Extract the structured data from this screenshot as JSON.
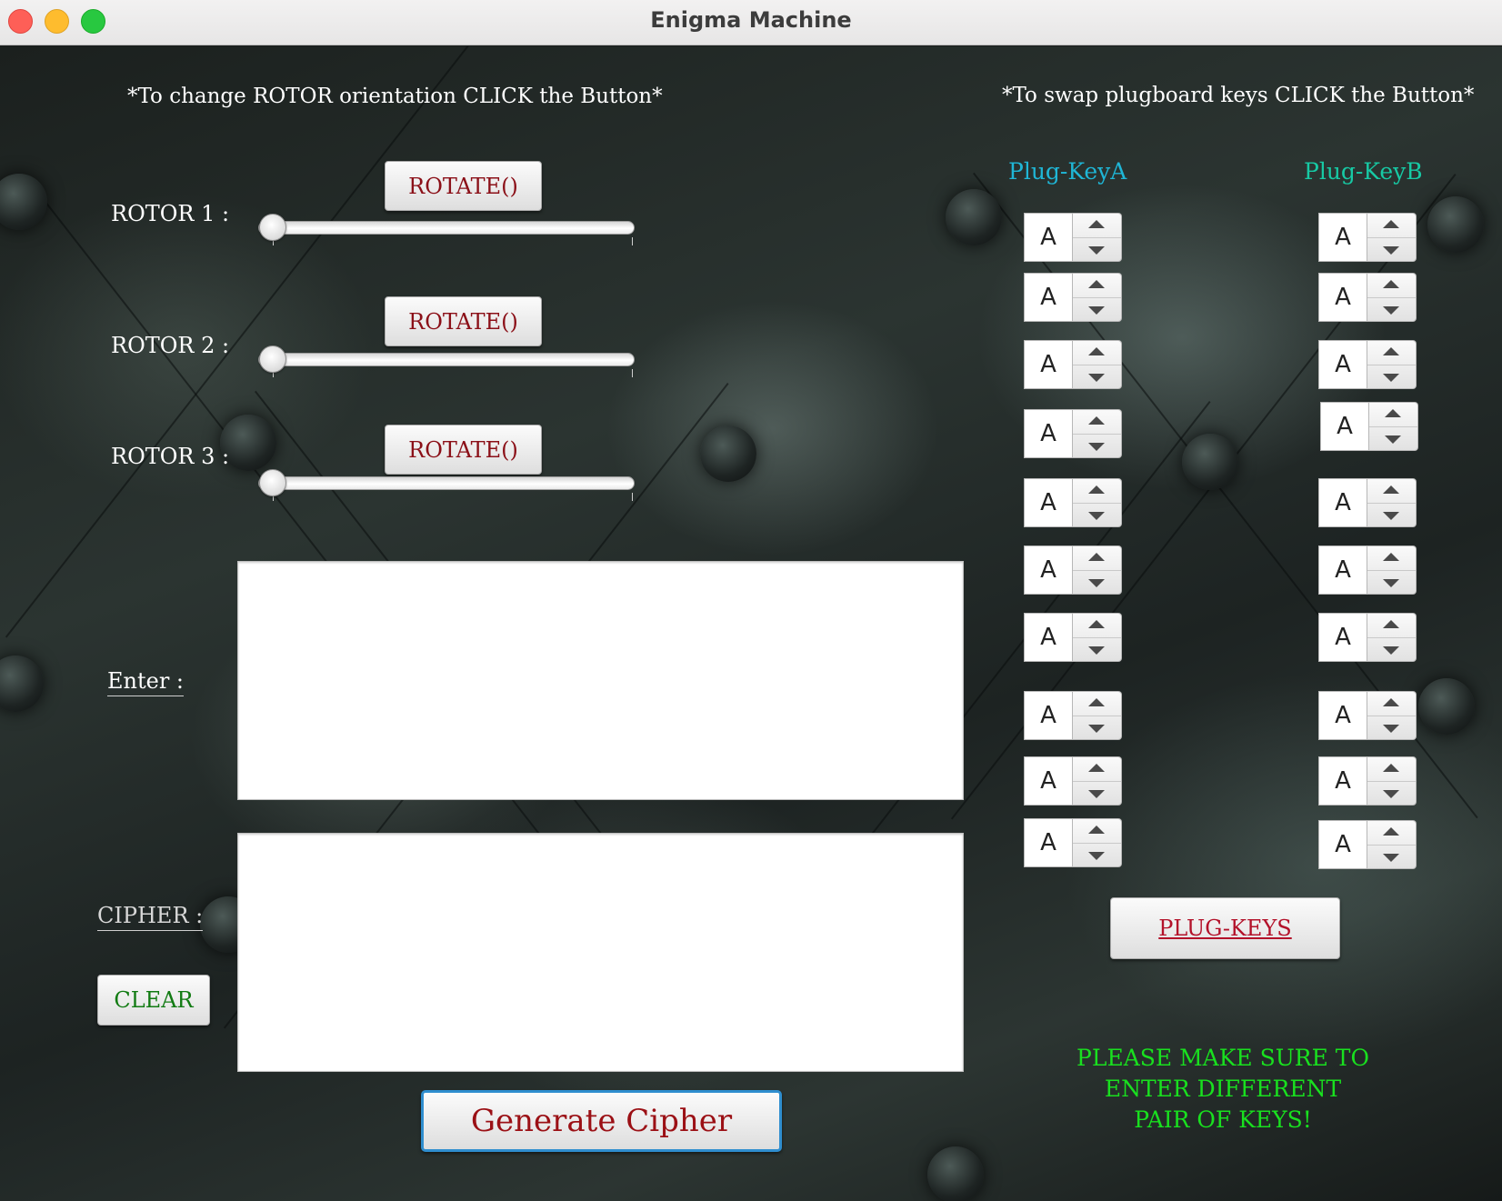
{
  "window": {
    "title": "Enigma Machine"
  },
  "hints": {
    "rotor": "*To change ROTOR orientation CLICK the Button*",
    "plugboard": "*To swap plugboard keys CLICK the Button*"
  },
  "rotors": [
    {
      "label": "ROTOR 1 :",
      "button": "ROTATE()",
      "position": 0
    },
    {
      "label": "ROTOR 2 :",
      "button": "ROTATE()",
      "position": 0
    },
    {
      "label": "ROTOR 3 :",
      "button": "ROTATE()",
      "position": 0
    }
  ],
  "input": {
    "label": "Enter :",
    "value": ""
  },
  "output": {
    "label": "CIPHER :",
    "value": ""
  },
  "buttons": {
    "clear": "CLEAR",
    "generate": "Generate Cipher",
    "plug_keys": "PLUG-KEYS"
  },
  "plugboard": {
    "column_a": "Plug-KeyA",
    "column_b": "Plug-KeyB",
    "column_a_color": "#1fb6d6",
    "column_b_color": "#17c9a4",
    "keys_a": [
      "A",
      "A",
      "A",
      "A",
      "A",
      "A",
      "A",
      "A",
      "A",
      "A"
    ],
    "keys_b": [
      "A",
      "A",
      "A",
      "A",
      "A",
      "A",
      "A",
      "A",
      "A",
      "A"
    ]
  },
  "warning": {
    "lines": [
      "PLEASE MAKE SURE TO",
      "ENTER   DIFFERENT",
      "PAIR OF KEYS!"
    ],
    "color": "#19e01f"
  }
}
